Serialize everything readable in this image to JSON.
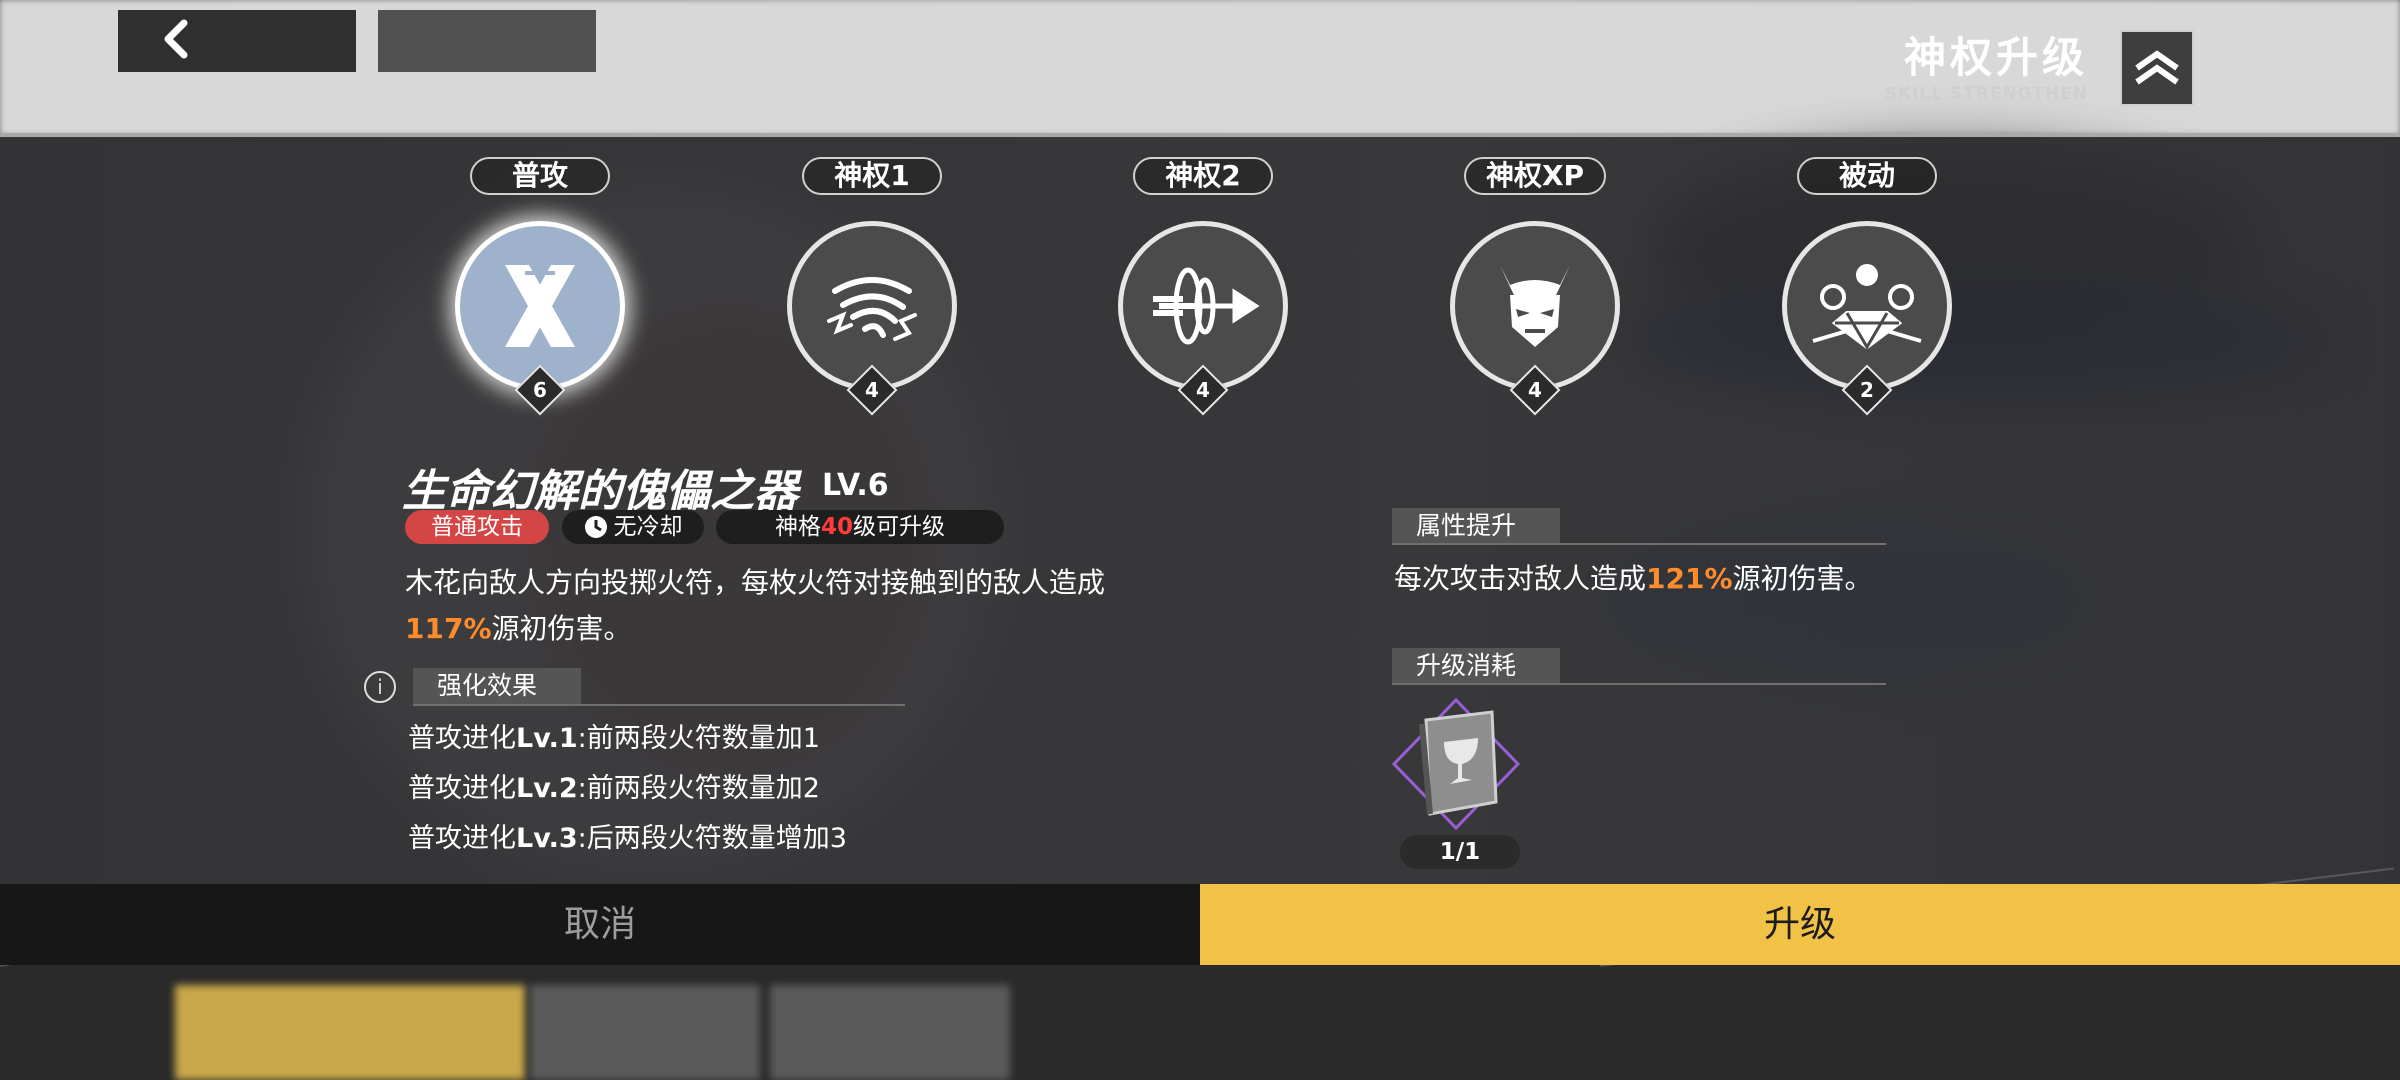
{
  "header": {
    "title": "神权升级",
    "subtitle": "SKILL STRENGTHEN",
    "icon": "chevron-up-double-icon"
  },
  "back_button": {
    "icon": "chevron-left-icon"
  },
  "skills": [
    {
      "label": "普攻",
      "level": "6",
      "icon": "crossed-blades-icon",
      "active": true
    },
    {
      "label": "神权1",
      "level": "4",
      "icon": "tornado-icon",
      "active": false
    },
    {
      "label": "神权2",
      "level": "4",
      "icon": "arrow-dash-icon",
      "active": false
    },
    {
      "label": "神权XP",
      "level": "4",
      "icon": "demon-mask-icon",
      "active": false
    },
    {
      "label": "被动",
      "level": "2",
      "icon": "diamond-orbs-icon",
      "active": false
    }
  ],
  "detail": {
    "name": "生命幻解的傀儡之器",
    "level": "LV.6",
    "tag_type": "普通攻击",
    "tag_cooldown": "无冷却",
    "tag_unlock_prefix": "神格",
    "tag_unlock_level": "40",
    "tag_unlock_suffix": "级可升级",
    "desc_line1": "木花向敌人方向投掷火符，每枚火符对接触到的敌人造成",
    "desc_value": "117%",
    "desc_line2_suffix": "源初伤害。",
    "enhance_title": "强化效果",
    "evolutions": [
      {
        "prefix": "普攻进化",
        "lv": "Lv.1",
        "text": ":前两段火符数量加1"
      },
      {
        "prefix": "普攻进化",
        "lv": "Lv.2",
        "text": ":前两段火符数量加2"
      },
      {
        "prefix": "普攻进化",
        "lv": "Lv.3",
        "text": ":后两段火符数量增加3"
      }
    ]
  },
  "attribute": {
    "title": "属性提升",
    "text_prefix": "每次攻击对敌人造成",
    "value": "121%",
    "text_suffix": "源初伤害。"
  },
  "cost": {
    "title": "升级消耗",
    "item_icon": "chalice-book-icon",
    "count": "1/1"
  },
  "buttons": {
    "cancel": "取消",
    "upgrade": "升级"
  },
  "colors": {
    "accent_yellow": "#f1c245",
    "highlight_orange": "#ff8c2b",
    "tag_red": "#d44545"
  }
}
